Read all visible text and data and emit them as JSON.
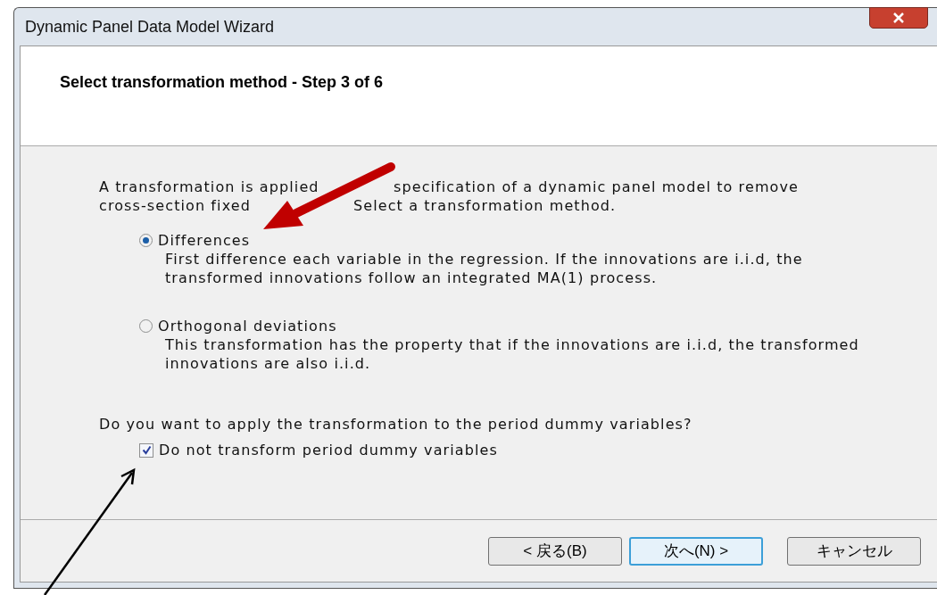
{
  "window": {
    "title": "Dynamic Panel Data Model Wizard"
  },
  "header": {
    "title": "Select transformation method - Step 3 of 6"
  },
  "intro": [
    [
      "A transformation is applied",
      "specification of a dynamic panel model to remove"
    ],
    [
      "cross-section fixed",
      "Select a transformation method."
    ]
  ],
  "options": [
    {
      "label": "Differences",
      "description": "First difference each variable in the regression. If the innovations are i.i.d, the transformed innovations follow an integrated MA(1) process.",
      "selected": true
    },
    {
      "label": "Orthogonal deviations",
      "description": "This transformation has the property that if the innovations are i.i.d, the transformed innovations are also i.i.d.",
      "selected": false
    }
  ],
  "question": "Do you want to apply the transformation to the period dummy variables?",
  "checkbox": {
    "label": "Do not transform period dummy variables",
    "checked": true
  },
  "buttons": [
    {
      "label": "< 戻る(B)",
      "default": false
    },
    {
      "label": "次へ(N) >",
      "default": true
    },
    {
      "label": "キャンセル",
      "default": false
    }
  ]
}
